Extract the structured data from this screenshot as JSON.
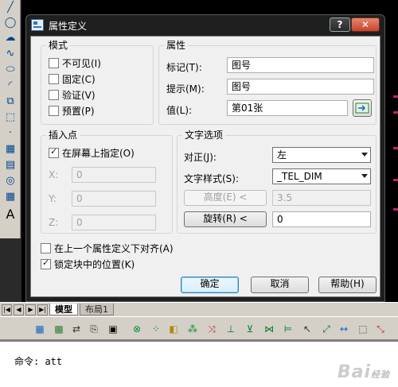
{
  "dialog": {
    "title": "属性定义",
    "help_btn": "?",
    "close_btn": "✕"
  },
  "mode": {
    "title": "模式",
    "items": [
      {
        "label": "不可见(I)",
        "checked": false
      },
      {
        "label": "固定(C)",
        "checked": false
      },
      {
        "label": "验证(V)",
        "checked": false
      },
      {
        "label": "预置(P)",
        "checked": false
      }
    ]
  },
  "attribute": {
    "title": "属性",
    "tag_label": "标记(T):",
    "tag_value": "图号",
    "prompt_label": "提示(M):",
    "prompt_value": "图号",
    "value_label": "值(L):",
    "value_value": "第01张"
  },
  "insertion": {
    "title": "插入点",
    "on_screen_label": "在屏幕上指定(O)",
    "on_screen_checked": true,
    "x_label": "X:",
    "x_value": "0",
    "y_label": "Y:",
    "y_value": "0",
    "z_label": "Z:",
    "z_value": "0"
  },
  "text_options": {
    "title": "文字选项",
    "justify_label": "对正(J):",
    "justify_value": "左",
    "style_label": "文字样式(S):",
    "style_value": "_TEL_DIM",
    "height_btn": "高度(E) <",
    "height_value": "3.5",
    "rotation_btn": "旋转(R) <",
    "rotation_value": "0"
  },
  "bottom": {
    "align_below_label": "在上一个属性定义下对齐(A)",
    "align_below_checked": false,
    "lock_position_label": "锁定块中的位置(K)",
    "lock_position_checked": true
  },
  "buttons": {
    "ok": "确定",
    "cancel": "取消",
    "help": "帮助(H)"
  },
  "tabs": {
    "model": "模型",
    "layout1": "布局1"
  },
  "command": {
    "line": "命令: att"
  },
  "watermark": "Bai",
  "watermark_sub": "经验"
}
